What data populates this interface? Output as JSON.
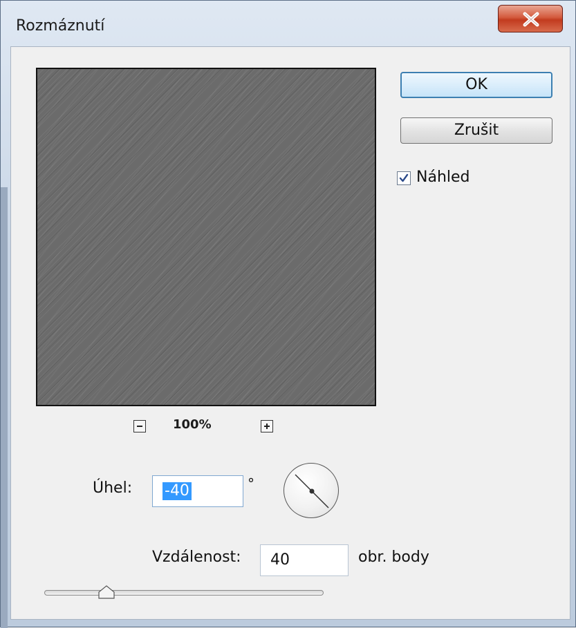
{
  "window": {
    "title": "Rozmáznutí"
  },
  "buttons": {
    "ok": "OK",
    "cancel": "Zrušit"
  },
  "preview_checkbox": {
    "label": "Náhled",
    "checked": true
  },
  "zoom": {
    "level": "100%"
  },
  "angle": {
    "label": "Úhel:",
    "value": "-40",
    "unit": "°"
  },
  "distance": {
    "label": "Vzdálenost:",
    "value": "40",
    "unit": "obr. body"
  },
  "icons": {
    "close": "close-icon",
    "zoom_out": "minus-icon",
    "zoom_in": "plus-icon",
    "check": "checkmark-icon",
    "dial": "angle-dial-icon"
  },
  "colors": {
    "ok_border": "#3c7fb1",
    "selection": "#3399ff",
    "close_button": "#c23b1f",
    "preview": "#6b6b6b"
  }
}
